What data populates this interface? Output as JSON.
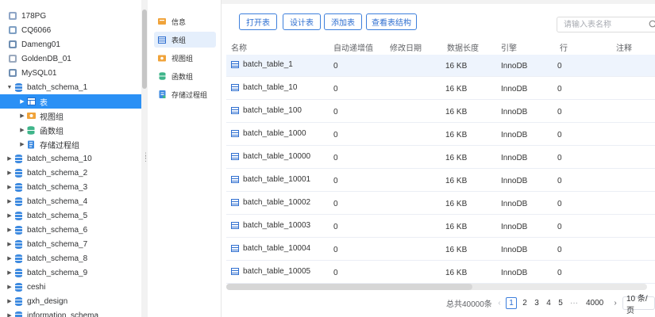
{
  "tree": {
    "items": [
      {
        "label": "178PG",
        "icon": "postgres-icon",
        "color": "#8fa6c7"
      },
      {
        "label": "CQ6066",
        "icon": "database-conn-icon",
        "color": "#7fa0c4"
      },
      {
        "label": "Dameng01",
        "icon": "dameng-icon",
        "color": "#6f8fb3"
      },
      {
        "label": "GoldenDB_01",
        "icon": "goldendb-icon",
        "color": "#9aa9be"
      },
      {
        "label": "MySQL01",
        "icon": "mysql-icon",
        "color": "#6f8fb3"
      },
      {
        "label": "batch_schema_1"
      },
      {
        "label": "表"
      },
      {
        "label": "视图组"
      },
      {
        "label": "函数组"
      },
      {
        "label": "存储过程组"
      },
      {
        "label": "batch_schema_10"
      },
      {
        "label": "batch_schema_2"
      },
      {
        "label": "batch_schema_3"
      },
      {
        "label": "batch_schema_4"
      },
      {
        "label": "batch_schema_5"
      },
      {
        "label": "batch_schema_6"
      },
      {
        "label": "batch_schema_7"
      },
      {
        "label": "batch_schema_8"
      },
      {
        "label": "batch_schema_9"
      },
      {
        "label": "ceshi"
      },
      {
        "label": "gxh_design"
      },
      {
        "label": "information_schema"
      }
    ]
  },
  "mid": {
    "items": [
      {
        "label": "信息",
        "icon": "info-icon"
      },
      {
        "label": "表组",
        "icon": "table-group-icon"
      },
      {
        "label": "视图组",
        "icon": "view-group-icon"
      },
      {
        "label": "函数组",
        "icon": "function-group-icon"
      },
      {
        "label": "存储过程组",
        "icon": "procedure-group-icon"
      }
    ]
  },
  "toolbar": {
    "open_table": "打开表",
    "design_table": "设计表",
    "add_table": "添加表",
    "view_structure": "查看表结构",
    "search_placeholder": "请输入表名称"
  },
  "table": {
    "columns": [
      "名称",
      "自动递增值",
      "修改日期",
      "数据长度",
      "引擎",
      "行",
      "注释"
    ],
    "rows": [
      {
        "name": "batch_table_1",
        "auto_inc": "0",
        "modified": "",
        "data_length": "16 KB",
        "engine": "InnoDB",
        "rows": "0",
        "comment": ""
      },
      {
        "name": "batch_table_10",
        "auto_inc": "0",
        "modified": "",
        "data_length": "16 KB",
        "engine": "InnoDB",
        "rows": "0",
        "comment": ""
      },
      {
        "name": "batch_table_100",
        "auto_inc": "0",
        "modified": "",
        "data_length": "16 KB",
        "engine": "InnoDB",
        "rows": "0",
        "comment": ""
      },
      {
        "name": "batch_table_1000",
        "auto_inc": "0",
        "modified": "",
        "data_length": "16 KB",
        "engine": "InnoDB",
        "rows": "0",
        "comment": ""
      },
      {
        "name": "batch_table_10000",
        "auto_inc": "0",
        "modified": "",
        "data_length": "16 KB",
        "engine": "InnoDB",
        "rows": "0",
        "comment": ""
      },
      {
        "name": "batch_table_10001",
        "auto_inc": "0",
        "modified": "",
        "data_length": "16 KB",
        "engine": "InnoDB",
        "rows": "0",
        "comment": ""
      },
      {
        "name": "batch_table_10002",
        "auto_inc": "0",
        "modified": "",
        "data_length": "16 KB",
        "engine": "InnoDB",
        "rows": "0",
        "comment": ""
      },
      {
        "name": "batch_table_10003",
        "auto_inc": "0",
        "modified": "",
        "data_length": "16 KB",
        "engine": "InnoDB",
        "rows": "0",
        "comment": ""
      },
      {
        "name": "batch_table_10004",
        "auto_inc": "0",
        "modified": "",
        "data_length": "16 KB",
        "engine": "InnoDB",
        "rows": "0",
        "comment": ""
      },
      {
        "name": "batch_table_10005",
        "auto_inc": "0",
        "modified": "",
        "data_length": "16 KB",
        "engine": "InnoDB",
        "rows": "0",
        "comment": ""
      }
    ]
  },
  "pager": {
    "total": "总共40000条",
    "pages": [
      "1",
      "2",
      "3",
      "4",
      "5"
    ],
    "ellipsis": "···",
    "last_page": "4000",
    "page_size": "10 条/页",
    "current": "1"
  },
  "colors": {
    "accent": "#2a90f5",
    "button": "#3d7fdc",
    "highlight_row": "#eef4fd"
  }
}
